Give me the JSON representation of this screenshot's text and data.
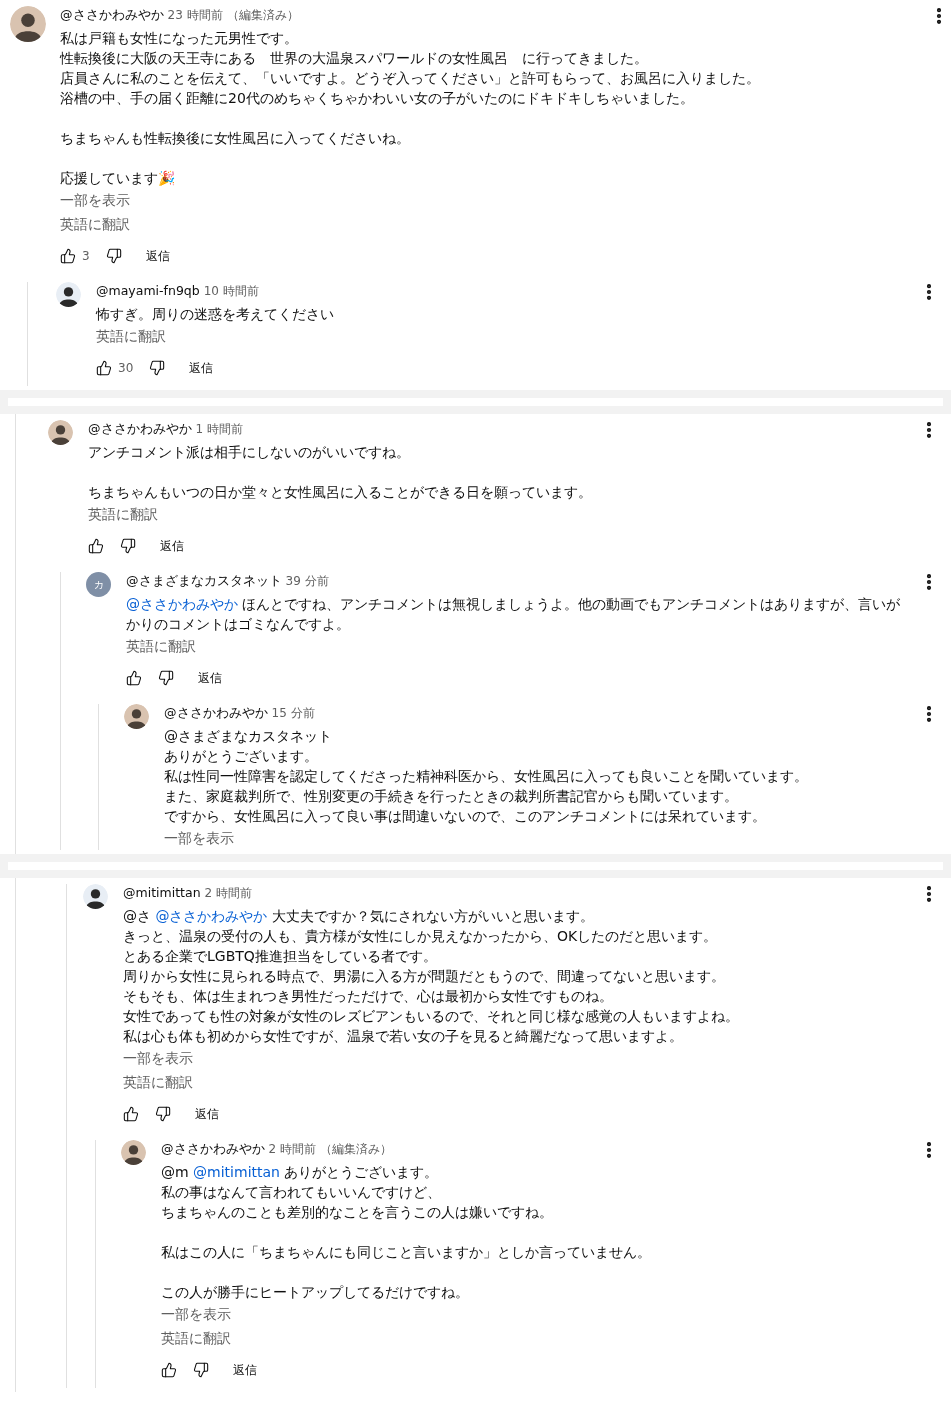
{
  "panels": [
    {
      "kind": "top",
      "comments": [
        {
          "author": "@ささかわみやか",
          "time": "23 時間前",
          "edited": "（編集済み）",
          "avatar": {
            "kind": "photo"
          },
          "paragraphs": [
            [
              "私は戸籍も女性になった元男性です。",
              "性転換後に大阪の天王寺にある　世界の大温泉スパワールドの女性風呂　に行ってきました。",
              "店員さんに私のことを伝えて、「いいですよ。どうぞ入ってください」と許可もらって、お風呂に入りました。",
              "浴槽の中、手の届く距離に20代のめちゃくちゃかわいい女の子がいたのにドキドキしちゃいました。"
            ],
            [
              "ちまちゃんも性転換後に女性風呂に入ってくださいね。"
            ],
            [
              "応援しています🎉"
            ]
          ],
          "show_more": "一部を表示",
          "translate": "英語に翻訳",
          "likes": "3",
          "reply": "返信",
          "children": [
            {
              "author": "@mayami-fn9qb",
              "time": "10 時間前",
              "avatar": {
                "kind": "drawing"
              },
              "paragraphs": [
                [
                  "怖すぎ。周りの迷惑を考えてください"
                ]
              ],
              "translate": "英語に翻訳",
              "likes": "30",
              "reply": "返信"
            }
          ]
        }
      ]
    },
    {
      "kind": "reply",
      "comments": [
        {
          "author": "@ささかわみやか",
          "time": "1 時間前",
          "avatar": {
            "kind": "photo"
          },
          "paragraphs": [
            [
              "アンチコメント派は相手にしないのがいいですね。"
            ],
            [
              "ちまちゃんもいつの日か堂々と女性風呂に入ることができる日を願っています。"
            ]
          ],
          "translate": "英語に翻訳",
          "reply": "返信",
          "children": [
            {
              "author": "@さまざまなカスタネット",
              "time": "39 分前",
              "avatar": {
                "kind": "letter",
                "letter": "カ"
              },
              "paragraphs": [
                [
                  {
                    "mention": "@ささかわみやか",
                    "text": " ほんとですね、アンチコメントは無視しましょうよ。他の動画でもアンチコメントはありますが、言いがかりのコメントはゴミなんですよ。"
                  }
                ]
              ],
              "translate": "英語に翻訳",
              "reply": "返信",
              "children": [
                {
                  "author": "@ささかわみやか",
                  "time": "15 分前",
                  "avatar": {
                    "kind": "photo"
                  },
                  "paragraphs": [
                    [
                      "@さまざまなカスタネット",
                      "ありがとうございます。",
                      "私は性同一性障害を認定してくださった精神科医から、女性風呂に入っても良いことを聞いています。",
                      "また、家庭裁判所で、性別変更の手続きを行ったときの裁判所書記官からも聞いています。",
                      "ですから、女性風呂に入って良い事は間違いないので、このアンチコメントには呆れています。"
                    ]
                  ],
                  "show_more": "一部を表示"
                }
              ]
            }
          ]
        }
      ]
    },
    {
      "kind": "deep",
      "comments": [
        {
          "author": "@mitimittan",
          "time": "2 時間前",
          "avatar": {
            "kind": "drawing"
          },
          "paragraphs": [
            [
              {
                "prefix": "@さ ",
                "mention": "@ささかわみやか",
                "text": " 大丈夫ですか？気にされない方がいいと思います。"
              },
              "きっと、温泉の受付の人も、貴方様が女性にしか見えなかったから、OKしたのだと思います。",
              "とある企業でLGBTQ推進担当をしている者です。",
              "周りから女性に見られる時点で、男湯に入る方が問題だともうので、間違ってないと思います。",
              "そもそも、体は生まれつき男性だっただけで、心は最初から女性ですものね。",
              "女性であっても性の対象が女性のレズビアンもいるので、それと同じ様な感覚の人もいますよね。",
              "私は心も体も初めから女性ですが、温泉で若い女の子を見ると綺麗だなって思いますよ。"
            ]
          ],
          "show_more": "一部を表示",
          "translate": "英語に翻訳",
          "reply": "返信",
          "children": [
            {
              "author": "@ささかわみやか",
              "time": "2 時間前",
              "edited": "（編集済み）",
              "avatar": {
                "kind": "photo"
              },
              "paragraphs": [
                [
                  {
                    "prefix": "@m ",
                    "mention": "@mitimittan",
                    "text": " ありがとうございます。"
                  },
                  "私の事はなんて言われてもいいんですけど、",
                  "ちまちゃんのことも差別的なことを言うこの人は嫌いですね。"
                ],
                [
                  "私はこの人に「ちまちゃんにも同じこと言いますか」としか言っていません。"
                ],
                [
                  "この人が勝手にヒートアップしてるだけですね。"
                ]
              ],
              "show_more": "一部を表示",
              "translate": "英語に翻訳",
              "reply": "返信"
            }
          ]
        }
      ]
    }
  ]
}
